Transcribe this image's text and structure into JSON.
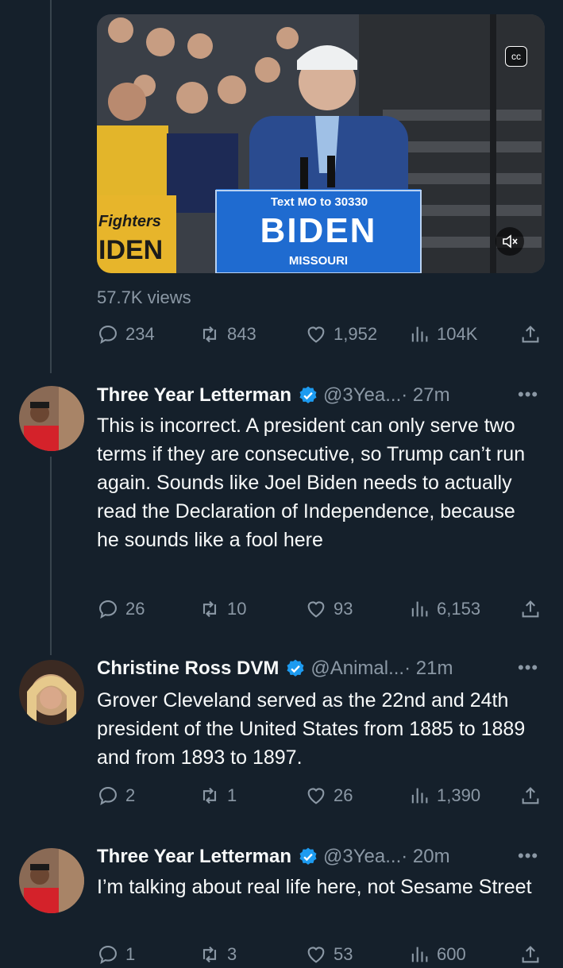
{
  "post": {
    "views_text": "57.7K views",
    "media": {
      "sign_text_top": "Text MO to 30330",
      "sign_text_main": "BIDEN",
      "sign_text_bottom": "MISSOURI",
      "left_sign_top": "Fighters",
      "left_sign_bottom": "IDEN",
      "cc_icon": "closed-captions-icon",
      "mute_icon": "speaker-muted-icon"
    },
    "stats": {
      "replies": "234",
      "reposts": "843",
      "likes": "1,952",
      "views": "104K"
    }
  },
  "replies": [
    {
      "name": "Three Year Letterman",
      "handle": "@3Yea...",
      "time": "· 27m",
      "text": "This is incorrect. A president can only serve two terms if they are consecutive, so Trump can’t run again. Sounds like Joel Biden needs to actually read the Declaration of Independence, because he sounds like a fool here",
      "stats": {
        "replies": "26",
        "reposts": "10",
        "likes": "93",
        "views": "6,153"
      }
    },
    {
      "name": "Christine Ross DVM",
      "handle": "@Animal...",
      "time": "· 21m",
      "text": "Grover Cleveland served as the 22nd and 24th president of the United States from 1885 to 1889 and from 1893 to 1897.",
      "stats": {
        "replies": "2",
        "reposts": "1",
        "likes": "26",
        "views": "1,390"
      }
    },
    {
      "name": "Three Year Letterman",
      "handle": "@3Yea...",
      "time": "· 20m",
      "text": "I’m talking about real life here, not Sesame Street",
      "stats": {
        "replies": "1",
        "reposts": "3",
        "likes": "53",
        "views": "600"
      }
    }
  ],
  "ui": {
    "more": "•••"
  },
  "colors": {
    "background": "#15202b",
    "muted_text": "#8b98a5",
    "verified": "#1d9bf0"
  }
}
